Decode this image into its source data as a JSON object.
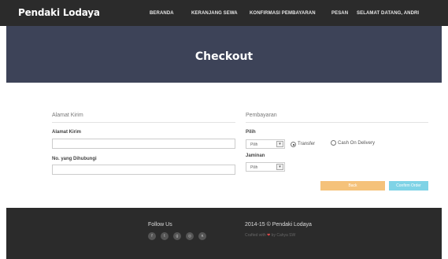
{
  "navbar": {
    "brand": "Pendaki Lodaya",
    "items": [
      "BERANDA",
      "KERANJANG SEWA",
      "KONFIRMASI PEMBAYARAN",
      "PESAN",
      "SELAMAT DATANG, ANDRI"
    ]
  },
  "hero": {
    "title": "Checkout"
  },
  "shipping": {
    "section_title": "Alamat Kirim",
    "address_label": "Alamat Kirim",
    "address_value": "",
    "phone_label": "No. yang Dihubungi",
    "phone_value": ""
  },
  "payment": {
    "section_title": "Pembayaran",
    "method_label": "Pilih",
    "method_select_value": "Pilih",
    "option_transfer": "Transfer",
    "option_cod": "Cash On Delivery",
    "selected_option": "Transfer",
    "guarantee_label": "Jaminan",
    "guarantee_select_value": "Pilih"
  },
  "buttons": {
    "back": "Back",
    "confirm": "Confirm Order"
  },
  "footer": {
    "follow_title": "Follow Us",
    "social_icons": [
      {
        "name": "facebook-icon",
        "glyph": "f"
      },
      {
        "name": "twitter-icon",
        "glyph": "t"
      },
      {
        "name": "google-plus-icon",
        "glyph": "g"
      },
      {
        "name": "instagram-icon",
        "glyph": "◎"
      },
      {
        "name": "rss-icon",
        "glyph": "ʀ"
      }
    ],
    "copyright": "2014-15 © Pendaki Lodaya",
    "credit_prefix": "Crafted with",
    "credit_suffix": "by Cahya SW"
  },
  "colors": {
    "navbar": "#2b2b2b",
    "hero": "#3d4358",
    "back_button": "#f5c27a",
    "confirm_button": "#7fd3e6",
    "heart": "#e04b4b"
  }
}
